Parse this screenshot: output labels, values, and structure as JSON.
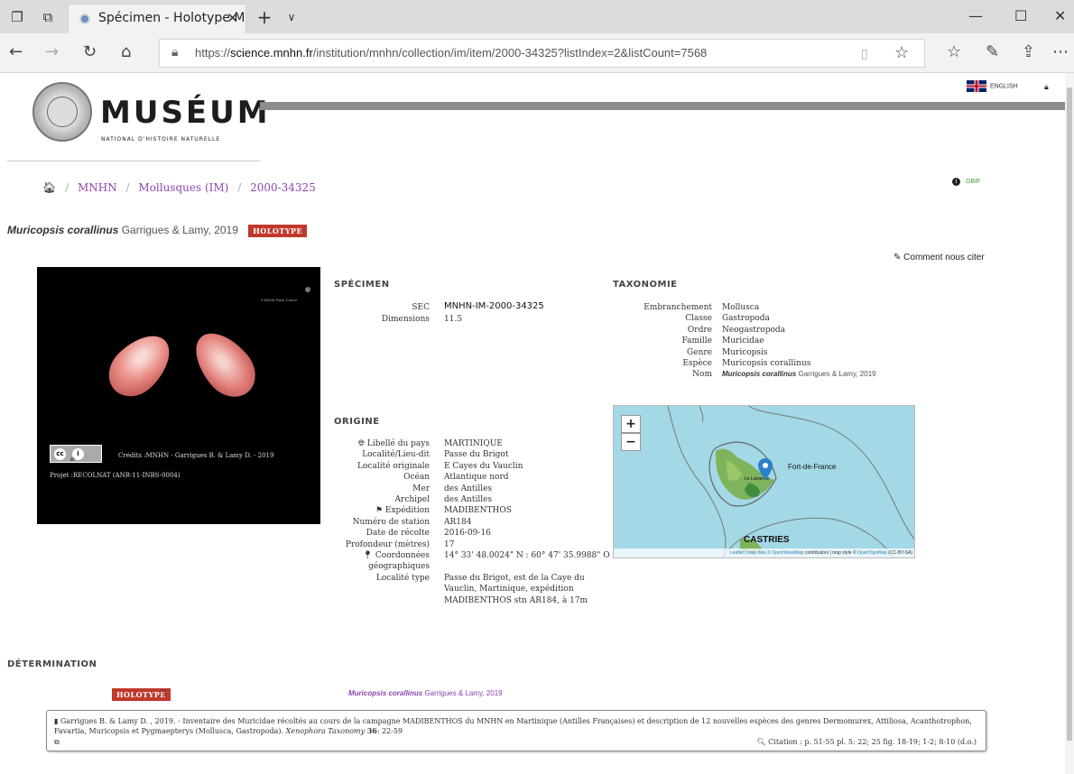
{
  "browser": {
    "tab_title": "Spécimen - Holotype M",
    "tab_close": "✕",
    "new_tab": "+",
    "tab_menu": "∨",
    "url_prefix": "https://",
    "url_host": "science.mnhn.fr",
    "url_path": "/institution/mnhn/collection/im/item/2000-34325?listIndex=2&listCount=7568"
  },
  "header": {
    "title": "MUSÉUM",
    "subtitle": "NATIONAL D'HISTOIRE NATURELLE",
    "language": "ENGLISH"
  },
  "breadcrumb": {
    "items": [
      "MNHN",
      "Mollusques (IM)",
      "2000-34325"
    ],
    "sep": "/"
  },
  "gbif_label": "GBIF",
  "specimen_title": {
    "name": "Muricopsis corallinus",
    "author": "Garrigues & Lamy, 2019",
    "badge": "HOLOTYPE"
  },
  "cite_link": "Comment nous citer",
  "photo": {
    "credits": "Crédits :MNHN - Garrigues B. & Lamy D. - 2019",
    "projet": "Projet :RECOLNAT (ANR-11-INBS-0004)",
    "cc_label": "cc",
    "by_label": "BY",
    "watermark": "Z MNHN\nParis, France"
  },
  "specimen": {
    "title": "SPÉCIMEN",
    "rows": [
      {
        "k": "SEC",
        "v": "MNHN-IM-2000-34325"
      },
      {
        "k": "Dimensions",
        "v": "11.5"
      }
    ]
  },
  "taxonomie": {
    "title": "TAXONOMIE",
    "rows": [
      {
        "k": "Embranchement",
        "v": "Mollusca"
      },
      {
        "k": "Classe",
        "v": "Gastropoda"
      },
      {
        "k": "Ordre",
        "v": "Neogastropoda"
      },
      {
        "k": "Famille",
        "v": "Muricidae"
      },
      {
        "k": "Genre",
        "v": "Muricopsis"
      },
      {
        "k": "Espèce",
        "v": "Muricopsis corallinus"
      },
      {
        "k": "Nom",
        "v_name": "Muricopsis corallinus",
        "v_author": "Garrigues & Lamy, 2019"
      }
    ]
  },
  "origine": {
    "title": "ORIGINE",
    "rows": [
      {
        "k": "Libellé du pays",
        "v": "MARTINIQUE"
      },
      {
        "k": "Localité/Lieu-dit",
        "v": "Passe du Brigot"
      },
      {
        "k": "Localité originale",
        "v": "E Cayes du Vauclin"
      },
      {
        "k": "Océan",
        "v": "Atlantique nord"
      },
      {
        "k": "Mer",
        "v": "des Antilles"
      },
      {
        "k": "Archipel",
        "v": "des Antilles"
      },
      {
        "k": "Expédition",
        "v": "MADIBENTHOS"
      },
      {
        "k": "Numéro de station",
        "v": "AR184"
      },
      {
        "k": "Date de récolte",
        "v": "2016-09-16"
      },
      {
        "k": "Profondeur (mètres)",
        "v": "17"
      },
      {
        "k": "Coordonnées",
        "k2": "géographiques",
        "v": "14° 33' 48.0024\" N : 60° 47' 35.9988\" O"
      },
      {
        "k": "Localité type",
        "v": "Passe du Brigot, est de la Caye du",
        "v2": "Vauclin, Martinique, expédition",
        "v3": "MADIBENTHOS stn AR184, à 17m"
      }
    ]
  },
  "map": {
    "zoom_in": "+",
    "zoom_out": "−",
    "place_fort": "Fort-de-France",
    "place_lamentin": "Le Lamentin",
    "place_castries": "CASTRIES",
    "attr_leaflet": "Leaflet",
    "attr_mid": " | map data © ",
    "attr_osm": "OpenStreetMap",
    "attr_mid2": " contributors | map style © ",
    "attr_otm": "OpenTopoMap",
    "attr_end": " (CC-BY-SA)"
  },
  "determination": {
    "title": "DÉTERMINATION",
    "badge": "HOLOTYPE",
    "species": "Muricopsis corallinus",
    "author": "Garrigues & Lamy, 2019",
    "reference_pre": "Garrigues B. & Lamy D. , 2019. - Inventaire des Muricidae récoltés au cours de la campagne MADIBENTHOS du MNHN en Martinique (Antilles Françaises) et description de 12 nouvelles espèces des genres Dermomurex, Attiliosa, Acanthotrophon, Favartia, Muricopsis et Pygmaepterys (Mollusca, Gastropoda). ",
    "reference_journal": "Xenophora Taxonomy",
    "reference_vol": "36",
    "reference_pages": ": 22-59",
    "citation": "Citation : p. 51-55 pl. 5: 22; 25 fig. 18-19; 1-2; 8-10 (d.o.)"
  }
}
